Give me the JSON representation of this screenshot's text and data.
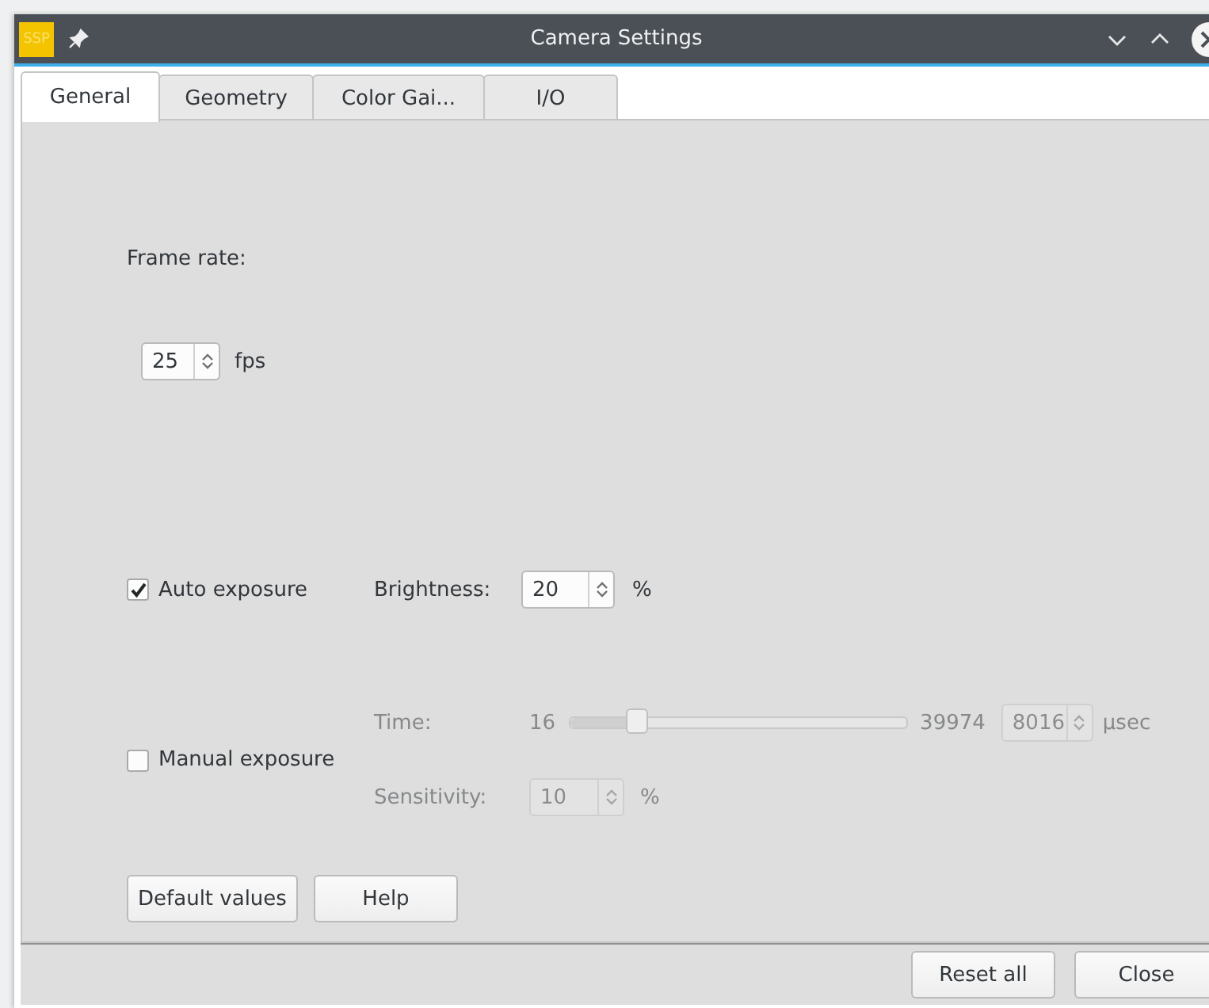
{
  "window": {
    "title": "Camera Settings",
    "app_badge": "SSP"
  },
  "tabs": [
    {
      "label": "General",
      "selected": true
    },
    {
      "label": "Geometry",
      "selected": false
    },
    {
      "label": "Color Gai...",
      "selected": false
    },
    {
      "label": "I/O",
      "selected": false
    }
  ],
  "frame_rate": {
    "label": "Frame rate:",
    "value": "25",
    "unit": "fps"
  },
  "auto_exposure": {
    "label": "Auto exposure",
    "checked": true,
    "brightness": {
      "label": "Brightness:",
      "value": "20",
      "unit": "%"
    }
  },
  "manual_exposure": {
    "label": "Manual exposure",
    "checked": false,
    "time": {
      "label": "Time:",
      "min": "16",
      "max": "39974",
      "level": 0.2,
      "value": "8016",
      "unit": "µsec",
      "disabled": true
    },
    "sensitivity": {
      "label": "Sensitivity:",
      "value": "10",
      "unit": "%",
      "disabled": true
    }
  },
  "buttons": [
    "Default values",
    "Help"
  ],
  "footer_buttons": [
    "Reset all",
    "Close"
  ]
}
